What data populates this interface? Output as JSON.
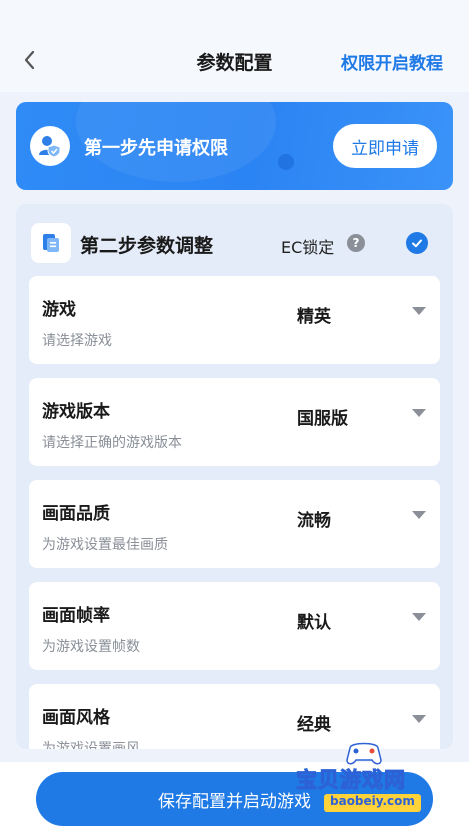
{
  "header": {
    "title": "参数配置",
    "help_link": "权限开启教程"
  },
  "step1": {
    "text": "第一步先申请权限",
    "button": "立即申请"
  },
  "step2": {
    "title": "第二步参数调整",
    "ec_label": "EC锁定",
    "ec_checked": true
  },
  "settings": [
    {
      "title": "游戏",
      "subtitle": "请选择游戏",
      "value": "精英"
    },
    {
      "title": "游戏版本",
      "subtitle": "请选择正确的游戏版本",
      "value": "国服版"
    },
    {
      "title": "画面品质",
      "subtitle": "为游戏设置最佳画质",
      "value": "流畅"
    },
    {
      "title": "画面帧率",
      "subtitle": "为游戏设置帧数",
      "value": "默认"
    },
    {
      "title": "画面风格",
      "subtitle": "为游戏设置画风",
      "value": "经典"
    }
  ],
  "footer": {
    "save_button": "保存配置并启动游戏"
  },
  "watermark": {
    "text": "宝贝游戏网",
    "url": "baobeiy.com"
  },
  "colors": {
    "accent": "#1f7ae6",
    "banner": "#2f8bf6",
    "panel": "#e4ecf9"
  }
}
